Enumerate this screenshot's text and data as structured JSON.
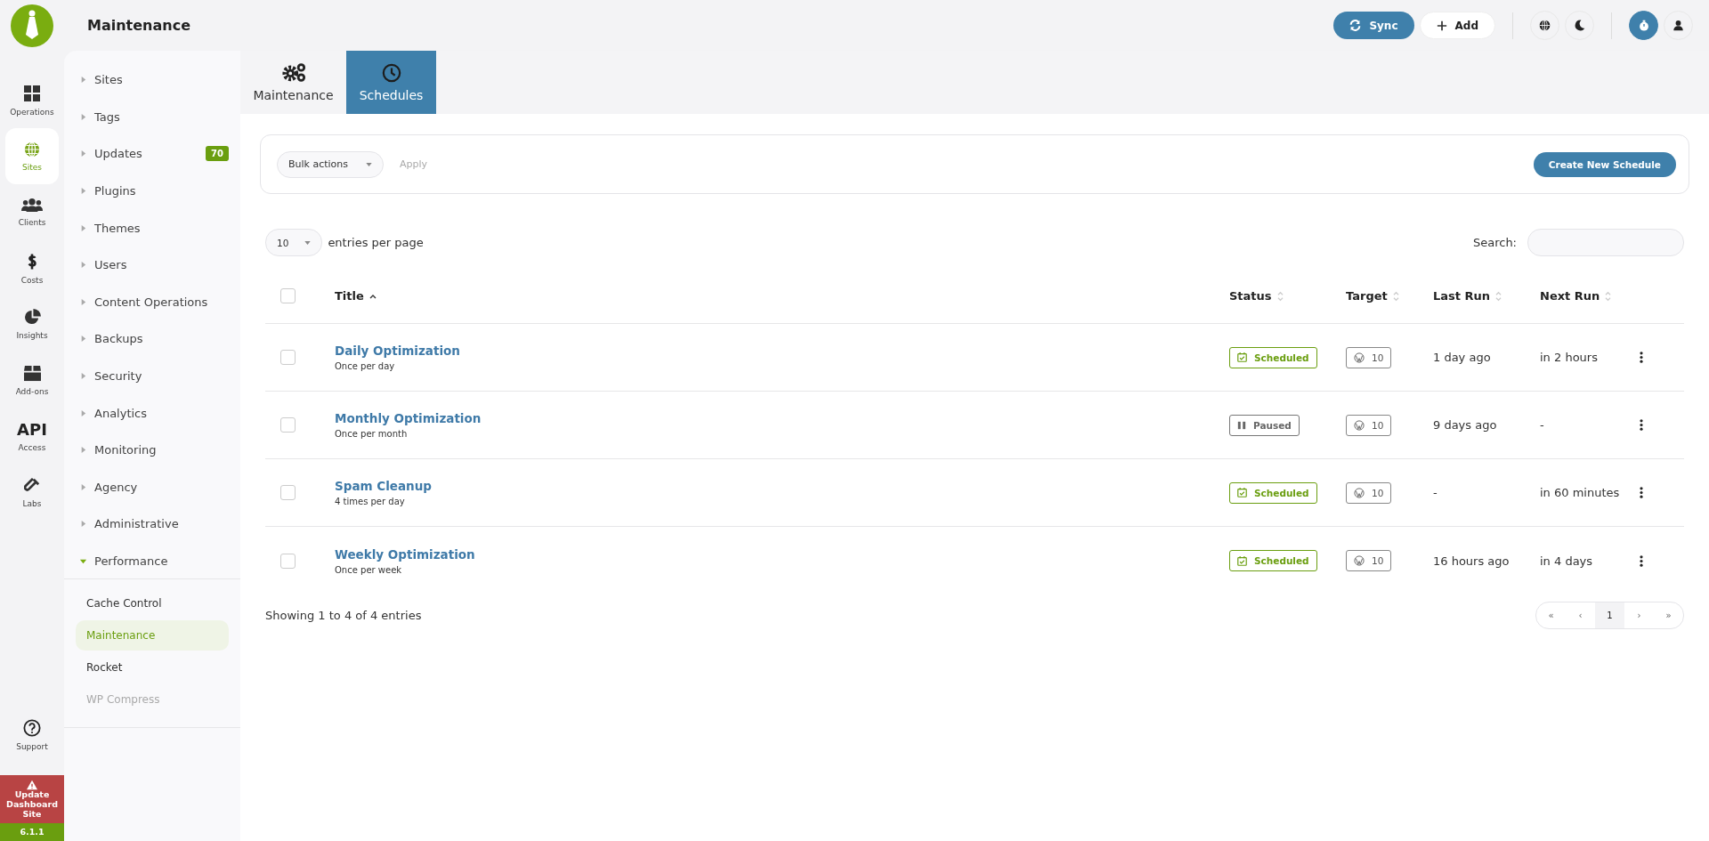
{
  "header": {
    "title": "Maintenance",
    "sync_button": "Sync",
    "add_button": "Add",
    "timer_active": true
  },
  "rail": {
    "items": [
      {
        "label": "Operations",
        "selected": false
      },
      {
        "label": "Sites",
        "selected": true
      },
      {
        "label": "Clients",
        "selected": false
      },
      {
        "label": "Costs",
        "selected": false
      },
      {
        "label": "Insights",
        "selected": false
      },
      {
        "label": "Add-ons",
        "selected": false
      },
      {
        "icon_text": "API",
        "label": "Access",
        "selected": false
      },
      {
        "label": "Labs",
        "selected": false
      }
    ],
    "support": "Support",
    "update_notice": "Update Dashboard Site",
    "version": "6.1.1"
  },
  "sidebar": {
    "groups": [
      {
        "label": "Sites",
        "expanded": false
      },
      {
        "label": "Tags",
        "expanded": false
      },
      {
        "label": "Updates",
        "expanded": false,
        "badge": "70"
      },
      {
        "label": "Plugins",
        "expanded": false
      },
      {
        "label": "Themes",
        "expanded": false
      },
      {
        "label": "Users",
        "expanded": false
      },
      {
        "label": "Content Operations",
        "expanded": false
      },
      {
        "label": "Backups",
        "expanded": false
      },
      {
        "label": "Security",
        "expanded": false
      },
      {
        "label": "Analytics",
        "expanded": false
      },
      {
        "label": "Monitoring",
        "expanded": false
      },
      {
        "label": "Agency",
        "expanded": false
      },
      {
        "label": "Administrative",
        "expanded": false
      },
      {
        "label": "Performance",
        "expanded": true,
        "children": [
          {
            "label": "Cache Control",
            "selected": false,
            "disabled": false
          },
          {
            "label": "Maintenance",
            "selected": true,
            "disabled": false
          },
          {
            "label": "Rocket",
            "selected": false,
            "disabled": false
          },
          {
            "label": "WP Compress",
            "selected": false,
            "disabled": true
          }
        ]
      }
    ]
  },
  "tabs": [
    {
      "label": "Maintenance",
      "selected": false
    },
    {
      "label": "Schedules",
      "selected": true
    }
  ],
  "toolbar": {
    "bulk_actions": "Bulk actions",
    "apply": "Apply",
    "create_button": "Create New Schedule"
  },
  "table_controls": {
    "page_size": "10",
    "page_size_label": "entries per page",
    "search_label": "Search:"
  },
  "table": {
    "select_all_checked": false,
    "columns": [
      {
        "label": "Title",
        "sorted": true
      },
      {
        "label": "Status",
        "sorted": false
      },
      {
        "label": "Target",
        "sorted": false
      },
      {
        "label": "Last Run",
        "sorted": false
      },
      {
        "label": "Next Run",
        "sorted": false
      }
    ],
    "rows": [
      {
        "checked": false,
        "title": "Daily Optimization",
        "frequency": "Once per day",
        "status": {
          "kind": "scheduled",
          "label": "Scheduled"
        },
        "target": "10",
        "last_run": "1 day ago",
        "next_run": "in 2 hours"
      },
      {
        "checked": false,
        "title": "Monthly Optimization",
        "frequency": "Once per month",
        "status": {
          "kind": "paused",
          "label": "Paused"
        },
        "target": "10",
        "last_run": "9 days ago",
        "next_run": "-"
      },
      {
        "checked": false,
        "title": "Spam Cleanup",
        "frequency": "4 times per day",
        "status": {
          "kind": "scheduled",
          "label": "Scheduled"
        },
        "target": "10",
        "last_run": "-",
        "next_run": "in 60 minutes"
      },
      {
        "checked": false,
        "title": "Weekly Optimization",
        "frequency": "Once per week",
        "status": {
          "kind": "scheduled",
          "label": "Scheduled"
        },
        "target": "10",
        "last_run": "16 hours ago",
        "next_run": "in 4 days"
      }
    ]
  },
  "footer": {
    "info": "Showing 1 to 4 of 4 entries",
    "pagination": [
      {
        "label": "«",
        "selected": false
      },
      {
        "label": "‹",
        "selected": false
      },
      {
        "label": "1",
        "selected": true
      },
      {
        "label": "›",
        "selected": false
      },
      {
        "label": "»",
        "selected": false
      }
    ]
  }
}
